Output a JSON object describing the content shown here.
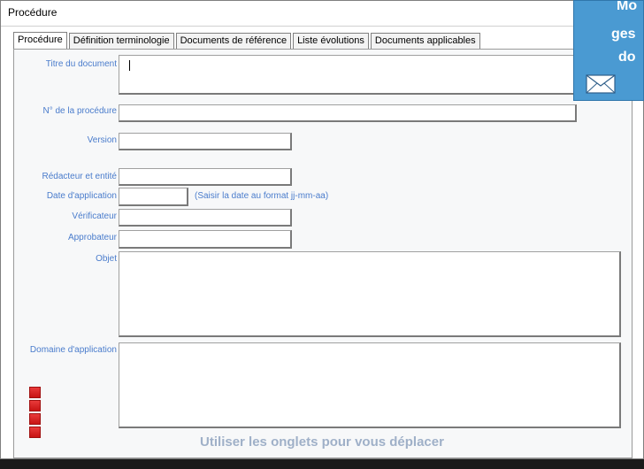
{
  "window": {
    "title": "Procédure"
  },
  "tabs": [
    {
      "label": "Procédure",
      "active": true
    },
    {
      "label": "Définition terminologie",
      "active": false
    },
    {
      "label": "Documents de référence",
      "active": false
    },
    {
      "label": "Liste évolutions",
      "active": false
    },
    {
      "label": "Documents applicables",
      "active": false
    }
  ],
  "form": {
    "titre_label": "Titre du document",
    "numero_label": "N° de la procédure",
    "version_label": "Version",
    "redacteur_label": "Rédacteur et entité",
    "date_label": "Date d'application",
    "date_hint": "(Saisir la date au format jj-mm-aa)",
    "verificateur_label": "Vérificateur",
    "approbateur_label": "Approbateur",
    "objet_label": "Objet",
    "domaine_label": "Domaine d'application"
  },
  "footer": {
    "note": "Utiliser les onglets pour vous déplacer"
  },
  "promo": {
    "line1": "Mo",
    "line2": "ges",
    "line3": "do"
  },
  "colors": {
    "label": "#4a7ccc",
    "accent": "#4a9ad2",
    "red_button": "#d42020"
  }
}
